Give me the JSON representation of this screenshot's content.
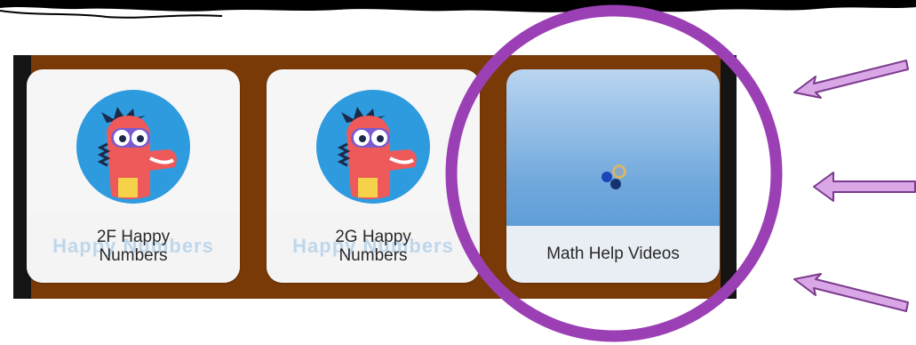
{
  "tiles": [
    {
      "caption": "2F Happy\nNumbers",
      "ghost_text": "Happy Numbers",
      "icon": "dino-mascot-icon"
    },
    {
      "caption": "2G Happy\nNumbers",
      "ghost_text": "Happy Numbers",
      "icon": "dino-mascot-icon"
    },
    {
      "caption": "Math Help Videos",
      "icon": "loading-spinner-icon"
    }
  ],
  "colors": {
    "panel": "#7a3a07",
    "highlight": "#9b3fb5",
    "arrow_fill": "#d9a6e6",
    "arrow_stroke": "#7b3a8f",
    "mascot_circle": "#2e9bdf",
    "mascot_body": "#ee5a5a"
  }
}
